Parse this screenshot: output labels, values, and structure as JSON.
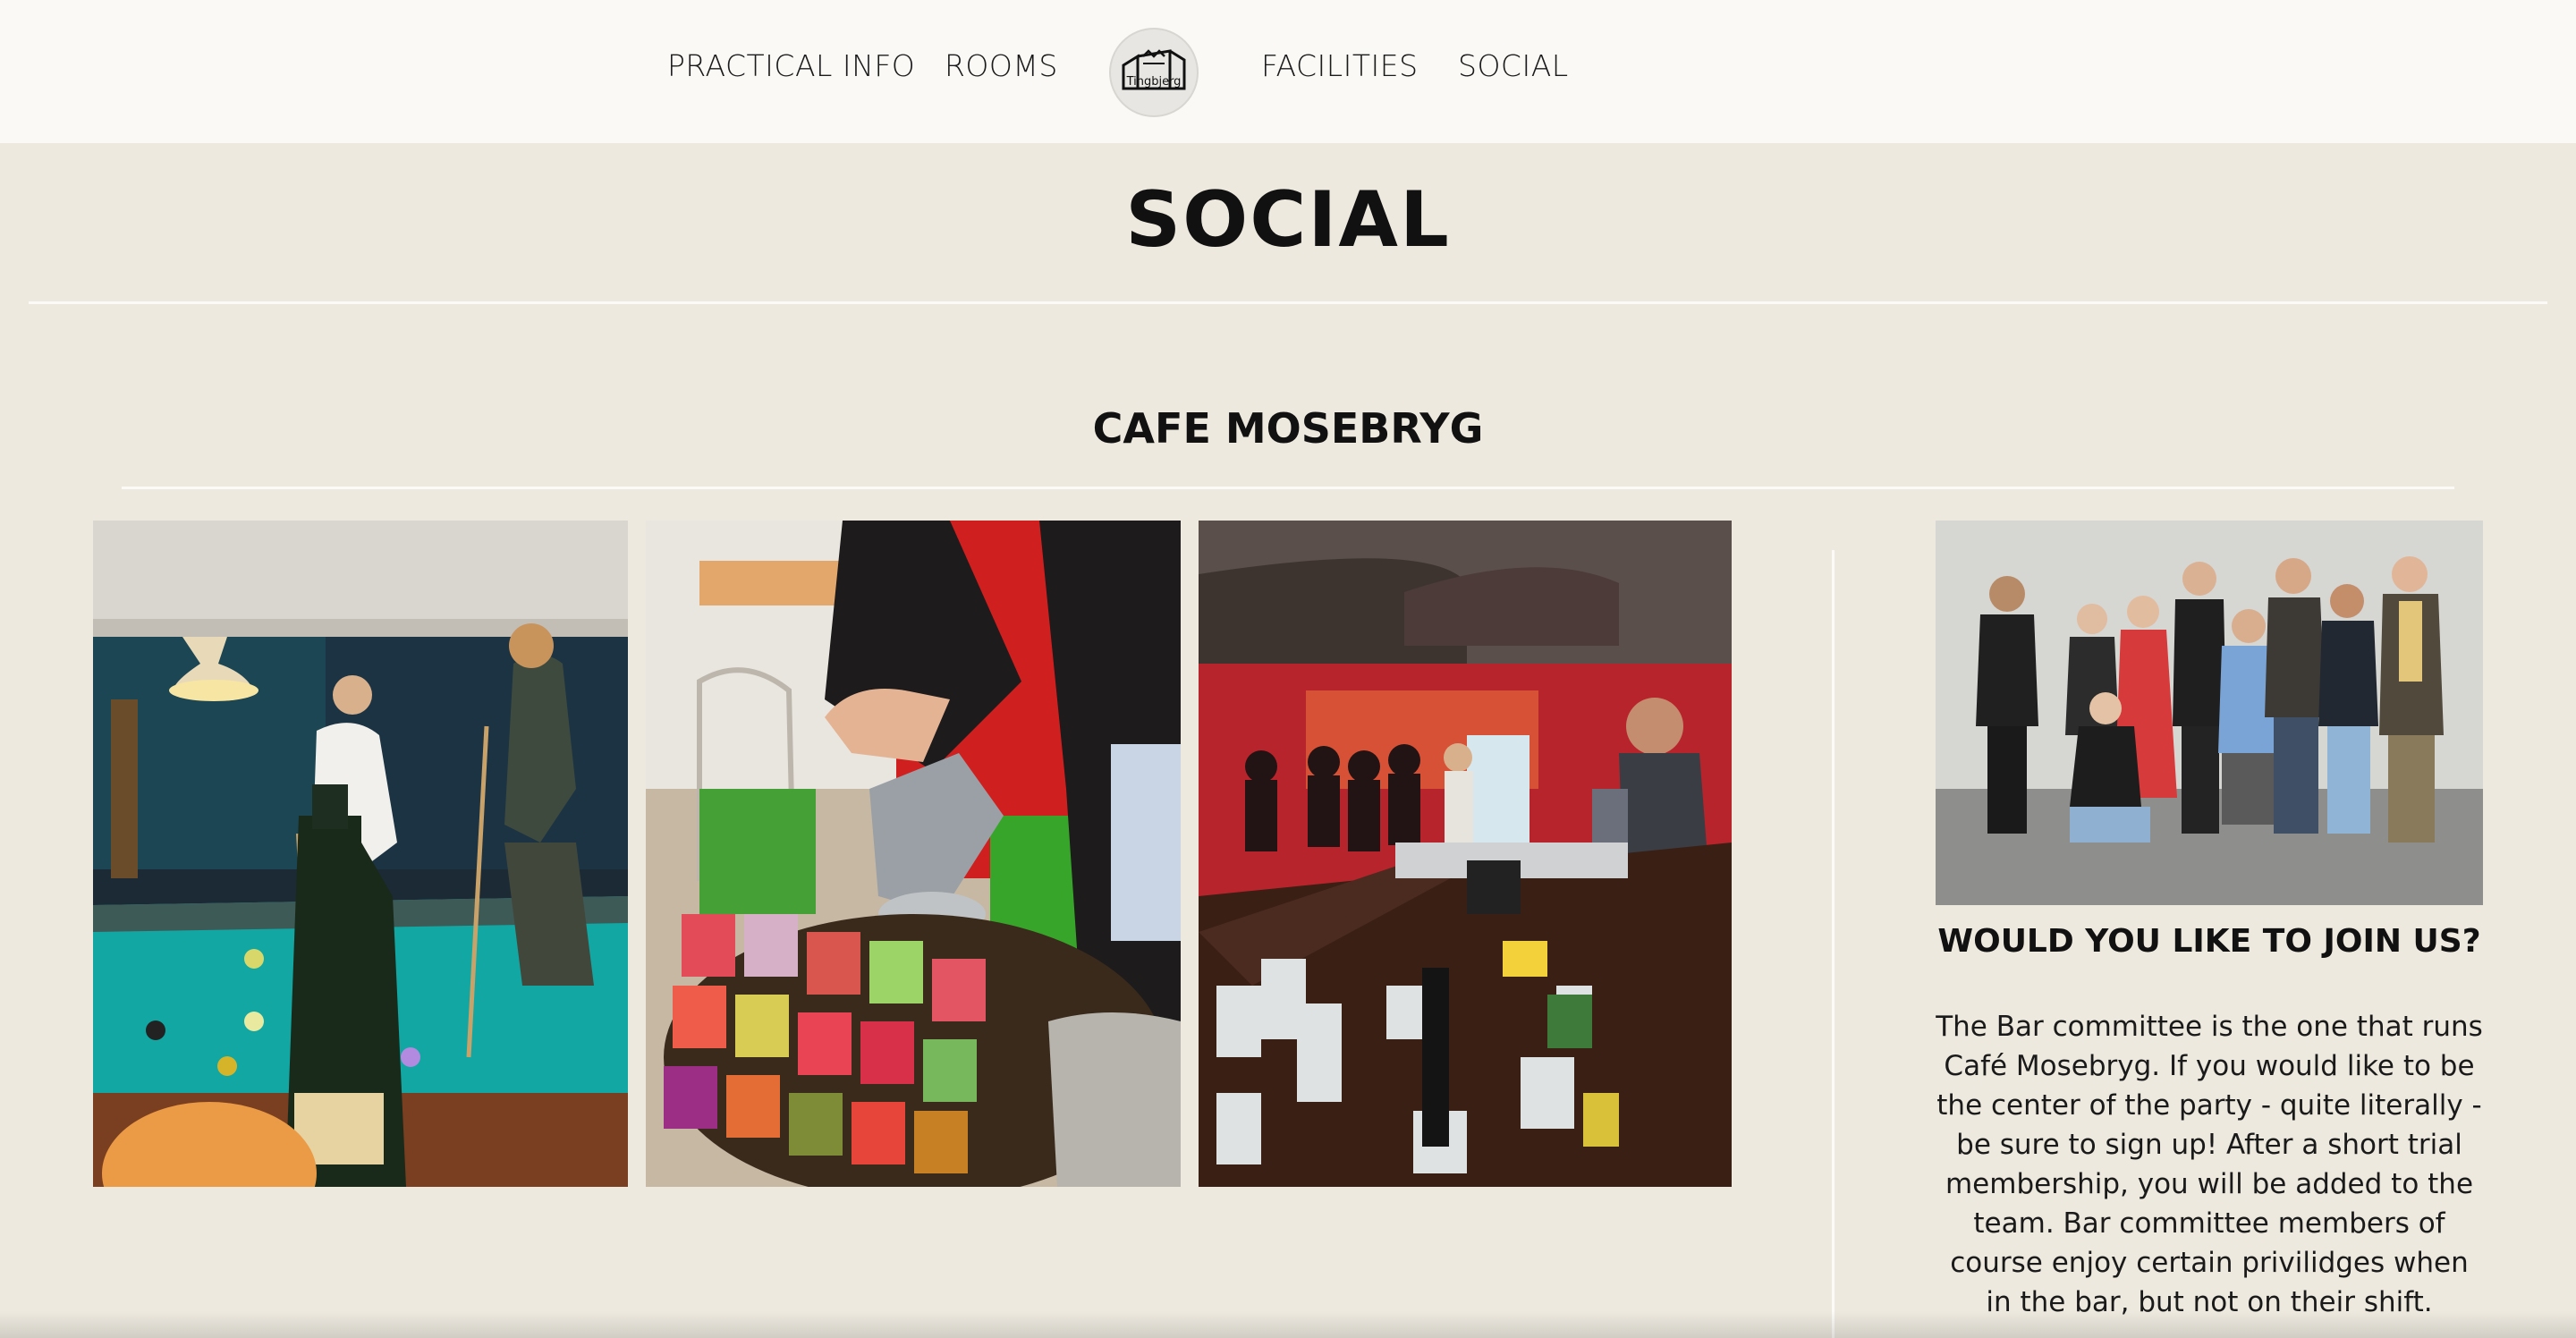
{
  "nav": {
    "items": [
      "PRACTICAL INFO",
      "ROOMS",
      "FACILITIES",
      "SOCIAL"
    ],
    "logo_text": "Tingbjerg"
  },
  "page": {
    "title": "SOCIAL"
  },
  "section": {
    "title": "CAFE MOSEBRYG"
  },
  "sidebar": {
    "join_title": "WOULD YOU LIKE TO JOIN US?",
    "join_text": "The Bar committee is the one that runs Café Mosebryg. If you would like to be the center of the party - quite literally - be sure to sign up! After a short trial membership, you will be added to the team. Bar committee members of course enjoy certain privilidges when in the bar, but not on their shift."
  },
  "colors": {
    "background": "#ede9df",
    "header": "#faf9f6",
    "rule": "#fbfaf7",
    "text": "#111111"
  }
}
